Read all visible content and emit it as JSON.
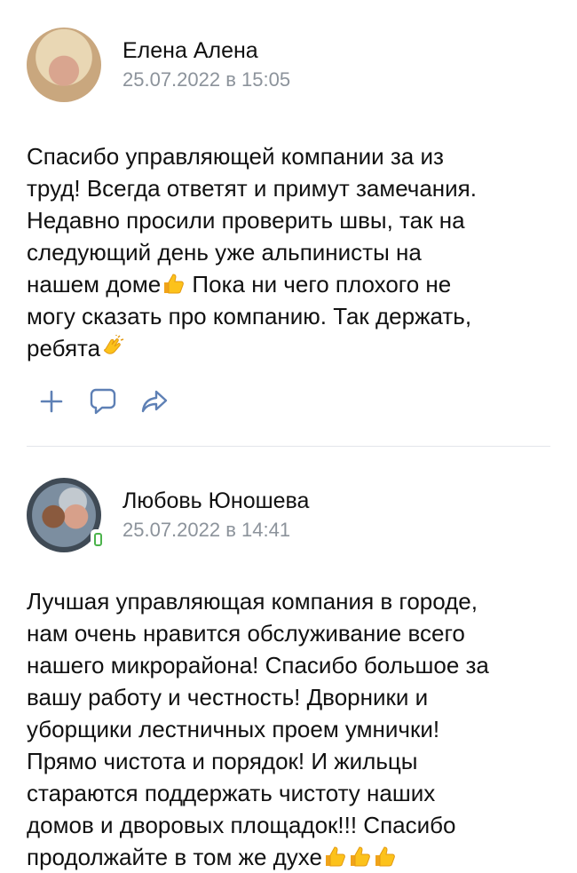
{
  "posts": [
    {
      "author": "Елена Алена",
      "date": "25.07.2022 в 15:05",
      "text_lines": [
        "Спасибо управляющей компании за из",
        "труд! Всегда ответят и примут замечания.",
        "Недавно просили проверить швы, так на",
        "следующий день уже альпинисты на",
        "нашем доме",
        " Пока ни чего плохого не",
        "могу сказать про компанию. Так держать,",
        "ребята"
      ],
      "emoji": [
        "thumbs-up",
        "clapping-hands"
      ]
    },
    {
      "author": "Любовь Юношева",
      "date": "25.07.2022 в 14:41",
      "text_lines": [
        "Лучшая управляющая компания в городе,",
        "нам очень нравится обслуживание всего",
        "нашего микрорайона! Спасибо большое за",
        "вашу работу и честность! Дворники и",
        "уборщики лестничных проем умнички!",
        "Прямо чистота и порядок! И жильцы",
        "стараются поддержать чистоту наших",
        "домов и дворовых площадок!!! Спасибо",
        "продолжайте в том же духе"
      ],
      "emoji": [
        "thumbs-up",
        "thumbs-up",
        "thumbs-up"
      ],
      "online": "mobile"
    }
  ],
  "actions": [
    "plus-icon",
    "comment-icon",
    "share-icon"
  ],
  "colors": {
    "text": "#111111",
    "date": "#8c939b",
    "icon": "#5e80b5",
    "online": "#4bb34b",
    "divider": "#e3e6ea"
  }
}
